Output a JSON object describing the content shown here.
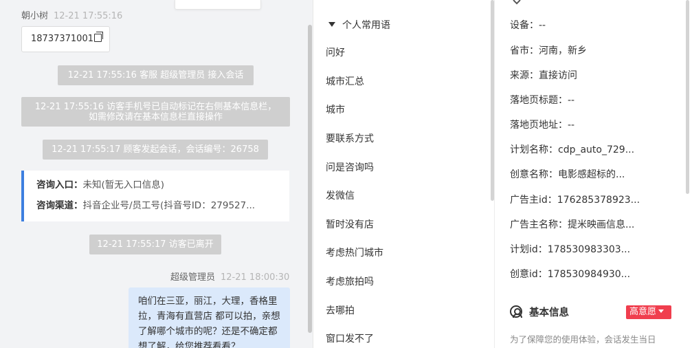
{
  "chat": {
    "visitor_name": "朝小树",
    "visitor_time": "12-21 17:55:16",
    "phone_message": "18737371001",
    "system_messages": [
      "12-21 17:55:16 客服 超级管理员 接入会话",
      "12-21 17:55:16 访客手机号已自动标记在右侧基本信息栏，",
      "如需修改请在基本信息栏直接操作",
      "12-21 17:55:17 顾客发起会话，会话编号：26758",
      "12-21 17:55:17 访客已离开"
    ],
    "consult_card": {
      "entry_label": "咨询入口：",
      "entry_value": "未知(暂无入口信息)",
      "channel_label": "咨询渠道：",
      "channel_value": "抖音企业号/员工号(抖音号ID：279527..."
    },
    "agent_name": "超级管理员",
    "agent_time": "12-21 18:00:30",
    "agent_message": "咱们在三亚，丽江，大理，香格里拉，青海有直营店 都可以拍，亲想了解哪个城市的呢？还是不确定都想了解，给您推荐看看？"
  },
  "phrases": {
    "group_title": "个人常用语",
    "items": [
      "问好",
      "城市汇总",
      "城市",
      "要联系方式",
      "问是咨询吗",
      "发微信",
      "暂时没有店",
      "考虑热门城市",
      "考虑旅拍吗",
      "去哪拍",
      "窗口发不了"
    ]
  },
  "info": {
    "fields": [
      "设备：--",
      "省市：河南，新乡",
      "来源：直接访问",
      "落地页标题：--",
      "落地页地址：--",
      "计划名称：cdp_auto_729...",
      "创意名称：电影感超标的...",
      "广告主id：176285378923...",
      "广告主名称：提米映画信息...",
      "计划id：178530983303...",
      "创意id：178530984930..."
    ],
    "basic_title": "基本信息",
    "intent_badge": "高意愿",
    "notice": "为了保障您的使用体验，会话发生当日"
  },
  "colors": {
    "accent_blue": "#3d7fe0",
    "badge_red": "#f03e4e",
    "agent_bubble": "#dbe9fb",
    "system_gray": "#cfcfcf"
  }
}
